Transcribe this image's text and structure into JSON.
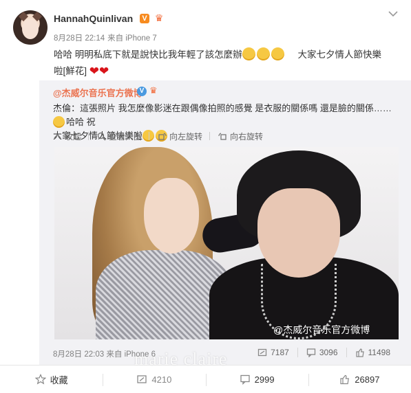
{
  "post": {
    "username": "HannahQuinlivan",
    "verified_badge": "V",
    "time": "8月28日 22:14",
    "source": "来自 iPhone 7",
    "text_line1": "哈哈 明明私底下就是說快比我年輕了該怎麼辦",
    "text_line1_tail": "大家七夕情人節快樂",
    "text_line2": "啦[鮮花]"
  },
  "repost": {
    "author": "@杰威尔音乐官方微博",
    "verified_badge": "V",
    "text_line1": "杰倫：這張照片 我怎麼像影迷在跟偶像拍照的感覺 是衣服的關係嗎 還是臉的關係……",
    "text_line1_tail": "哈哈 祝",
    "text_line2": "大家七夕情人節快樂啦",
    "tools": {
      "collapse": "收起",
      "view_large": "查看大图",
      "rotate_left": "向左旋转",
      "rotate_right": "向右旋转"
    },
    "photo_watermark": "@杰威尔音乐官方微博",
    "time": "8月28日 22:03",
    "source": "来自 iPhone 6",
    "stats": {
      "reposts": "7187",
      "comments": "3096",
      "likes": "11498"
    }
  },
  "overlay_watermark": "marie claire",
  "actions": {
    "favorite": "收藏",
    "repost": "4210",
    "comment": "2999",
    "like": "26897"
  },
  "icons": [
    "caret-down-icon",
    "collapse-icon",
    "zoom-icon",
    "rotate-left-icon",
    "rotate-right-icon",
    "repost-icon",
    "comment-icon",
    "like-icon",
    "star-icon"
  ]
}
